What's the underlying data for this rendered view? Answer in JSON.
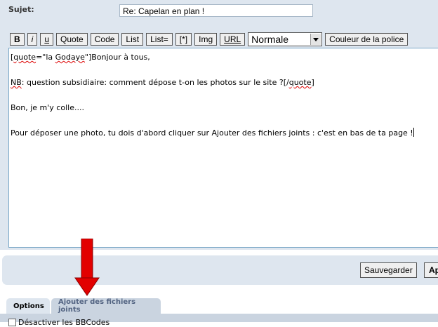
{
  "subject": {
    "label": "Sujet:",
    "value": "Re: Capelan en plan !"
  },
  "toolbar": {
    "buttons": [
      "B",
      "i",
      "u",
      "Quote",
      "Code",
      "List",
      "List=",
      "[*]",
      "Img",
      "URL"
    ],
    "font_size_value": "Normale",
    "font_color_label": "Couleur de la police"
  },
  "message": {
    "line1_a": "[",
    "line1_b": "quote",
    "line1_c": "=\"la ",
    "line1_d": "Godaye",
    "line1_e": "\"]Bonjour à tous,",
    "line2_a": "NB",
    "line2_b": ": question subsidiaire: comment dépose t-on les photos sur le site ?[/",
    "line2_c": "quote",
    "line2_d": "]",
    "line3": "Bon, je m'y colle....",
    "line4": "Pour déposer une photo, tu dois d'abord cliquer sur Ajouter des fichiers joints : c'est en bas de ta page !"
  },
  "actions": {
    "save_label": "Sauvegarder",
    "next_label": "Ap"
  },
  "tabs": [
    {
      "label": "Options"
    },
    {
      "label": "Ajouter des fichiers joints"
    }
  ],
  "options": {
    "disable_bbcode_label": "Désactiver les BBCodes"
  },
  "colors": {
    "panel_bg": "#dee6ef",
    "textarea_border": "#7aa7c7",
    "annotation_arrow": "#e20000"
  },
  "annotation": {
    "icon": "down-arrow-icon"
  }
}
